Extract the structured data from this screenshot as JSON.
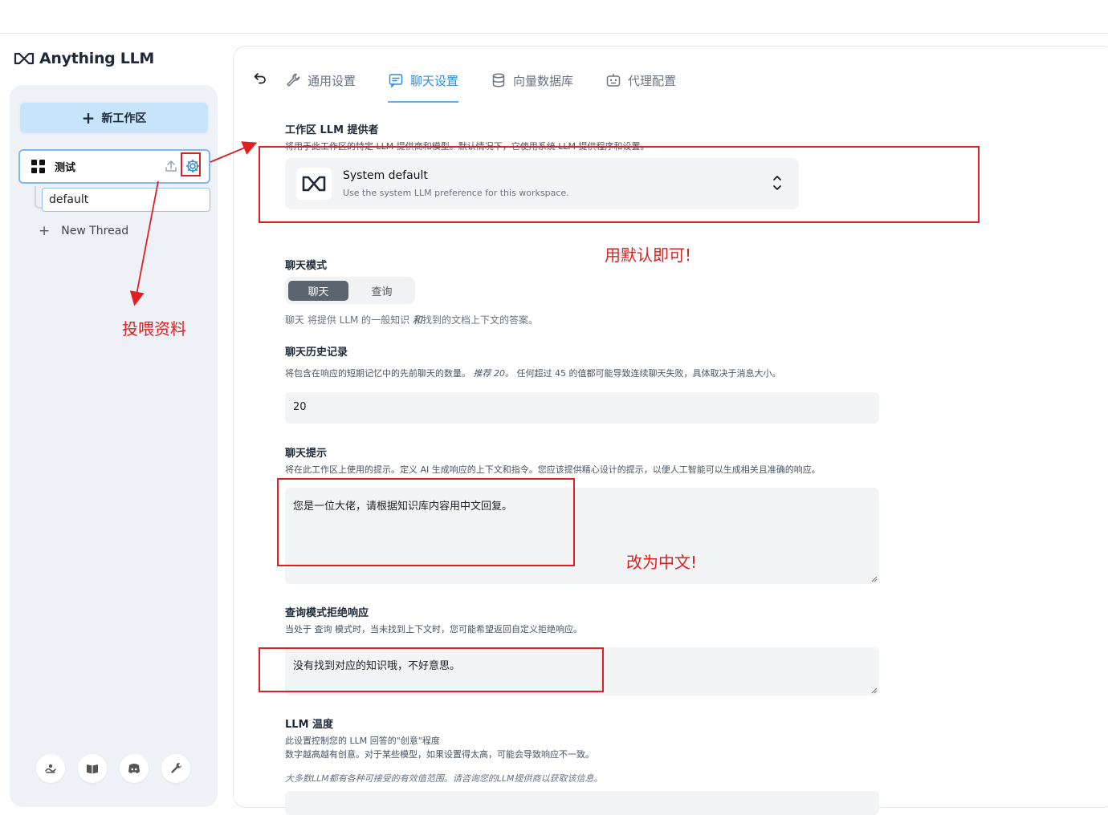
{
  "app": {
    "logo_text": "Anything LLM"
  },
  "sidebar": {
    "new_workspace_label": "新工作区",
    "workspace_name": "测试",
    "thread_name": "default",
    "new_thread_label": "New Thread"
  },
  "tabs": [
    {
      "label": "通用设置",
      "icon": "wrench-icon",
      "active": false
    },
    {
      "label": "聊天设置",
      "icon": "chat-icon",
      "active": true
    },
    {
      "label": "向量数据库",
      "icon": "database-icon",
      "active": false
    },
    {
      "label": "代理配置",
      "icon": "robot-icon",
      "active": false
    }
  ],
  "settings": {
    "provider": {
      "title": "工作区 LLM 提供者",
      "desc": "将用于此工作区的特定 LLM 提供商和模型。默认情况下，它使用系统 LLM 提供程序和设置。",
      "name": "System default",
      "sub": "Use the system LLM preference for this workspace."
    },
    "chat_mode": {
      "title": "聊天模式",
      "options": [
        "聊天",
        "查询"
      ],
      "selected": "聊天",
      "desc_prefix": "聊天 将提供 LLM 的一般知识 ",
      "desc_em": "和",
      "desc_suffix": "找到的文档上下文的答案。"
    },
    "history": {
      "title": "聊天历史记录",
      "desc_a": "将包含在响应的短期记忆中的先前聊天的数量。",
      "desc_em": "推荐 20。",
      "desc_b": "任何超过 45 的值都可能导致连续聊天失败，具体取决于消息大小。",
      "value": "20"
    },
    "prompt": {
      "title": "聊天提示",
      "desc": "将在此工作区上使用的提示。定义 AI 生成响应的上下文和指令。您应该提供精心设计的提示，以便人工智能可以生成相关且准确的响应。",
      "value": "您是一位大佬，请根据知识库内容用中文回复。"
    },
    "refusal": {
      "title": "查询模式拒绝响应",
      "desc": "当处于 查询 模式时，当未找到上下文时，您可能希望返回自定义拒绝响应。",
      "value": "没有找到对应的知识哦，不好意思。"
    },
    "temperature": {
      "title": "LLM 温度",
      "desc1": "此设置控制您的 LLM 回答的\"创意\"程度",
      "desc2": "数字越高越有创意。对于某些模型，如果设置得太高，可能会导致响应不一致。",
      "note": "大多数LLM都有各种可接受的有效值范围。请咨询您的LLM提供商以获取该信息。"
    }
  },
  "annotations": {
    "feed_data": "投喂资料",
    "use_default": "用默认即可!",
    "change_chinese": "改为中文!"
  },
  "colors": {
    "accent": "#2f8cd8",
    "annotation": "#e02020",
    "sidebar_bg": "#eef1f6"
  }
}
